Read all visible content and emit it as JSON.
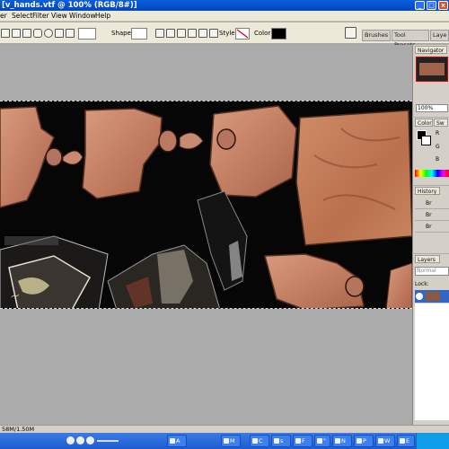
{
  "window": {
    "title": "[v_hands.vtf @ 100% (RGB/8#)]",
    "minimize_glyph": "_",
    "maximize_glyph": "□",
    "close_glyph": "x"
  },
  "menu": {
    "items": [
      "er",
      "Select",
      "Filter",
      "View",
      "Window",
      "Help"
    ]
  },
  "options": {
    "shape_label": "Shape:",
    "style_label": "Style:",
    "color_label": "Color:",
    "color_value": "#000000"
  },
  "dock_tabs": [
    "Brushes",
    "Tool Presets",
    "Laye"
  ],
  "navigator": {
    "tab": "Navigator",
    "zoom": "100%"
  },
  "color_panel": {
    "tabs": [
      "Color",
      "Sw"
    ],
    "channels": [
      "R",
      "G",
      "B"
    ]
  },
  "history": {
    "tab": "History",
    "items": [
      "Br",
      "Br",
      "Br"
    ]
  },
  "layers": {
    "tab": "Layers",
    "blend_mode": "Normal",
    "lock_label": "Lock:"
  },
  "status": {
    "doc_size": "58M/1.50M"
  },
  "taskbar": {
    "items": [
      "A",
      "M",
      "C",
      "s",
      "F",
      "\"",
      "N",
      "P",
      "W",
      "E"
    ]
  }
}
